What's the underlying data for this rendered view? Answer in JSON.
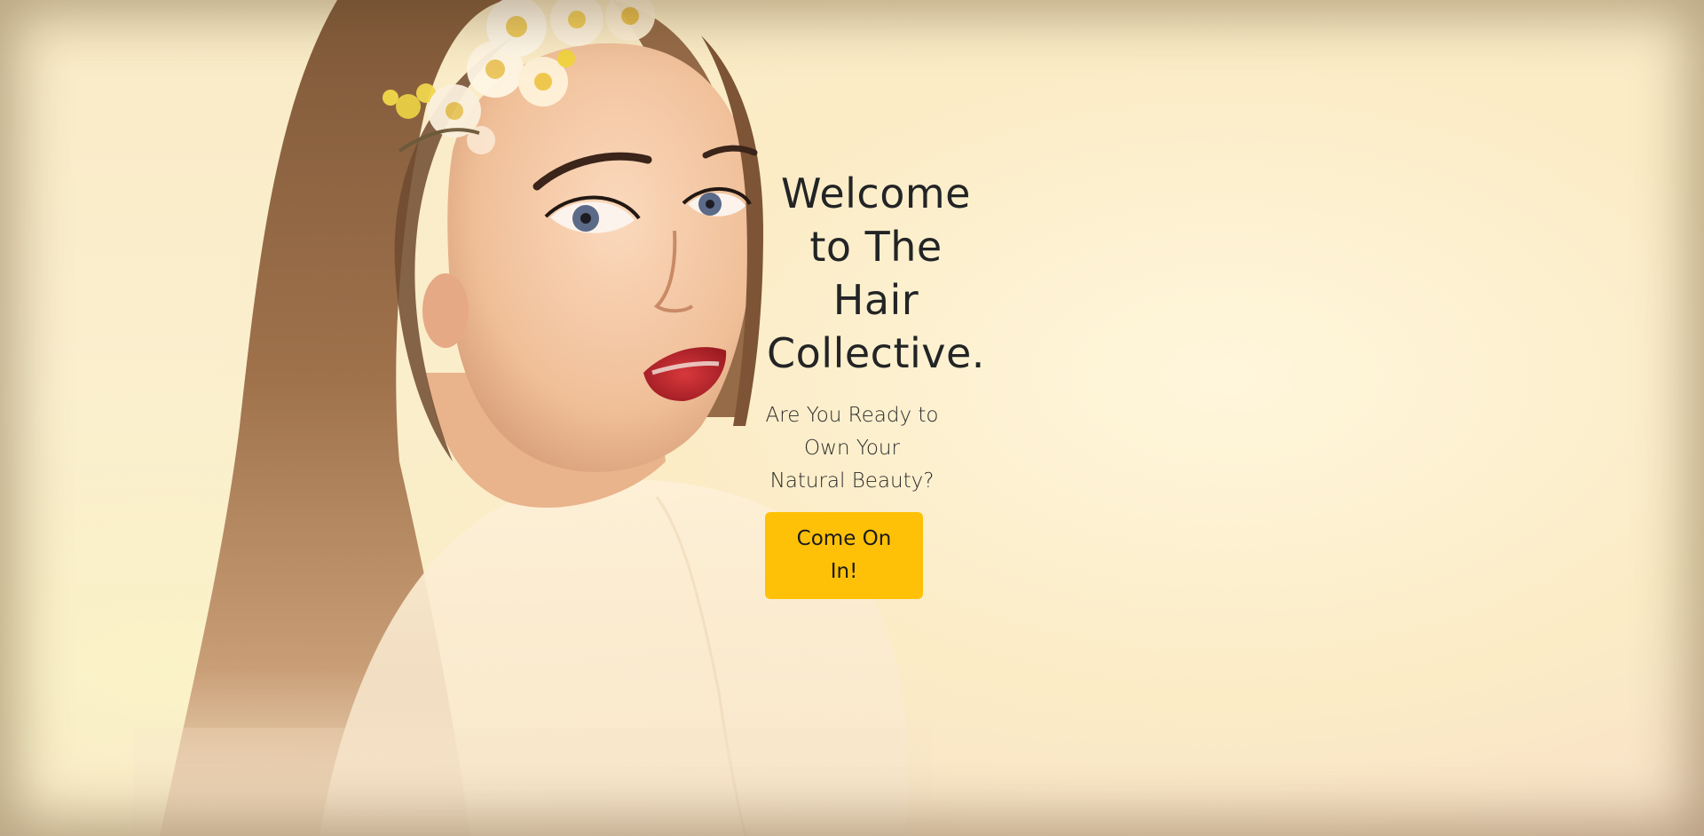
{
  "hero": {
    "title": "Welcome to The Hair Collective.",
    "subtitle": "Are You Ready to Own Your Natural Beauty?",
    "cta_label": "Come On In!"
  },
  "colors": {
    "background": "#f9ebc6",
    "button": "#ffc107",
    "title_text": "#222425"
  },
  "background_image": {
    "icon": "woman-with-flower-crown-photo"
  }
}
